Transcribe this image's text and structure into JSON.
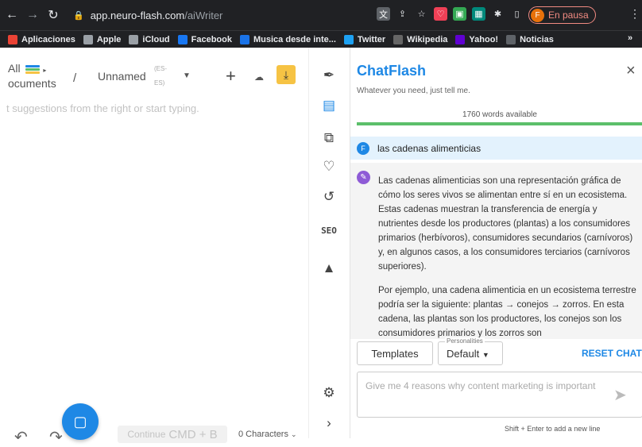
{
  "browser": {
    "url_host": "app.neuro-flash.com",
    "url_path": "/aiWriter",
    "profile_initial": "F",
    "profile_status": "En pausa"
  },
  "bookmarks": [
    {
      "label": "Aplicaciones",
      "color": "#ea4335"
    },
    {
      "label": "Apple",
      "color": "#9aa0a6"
    },
    {
      "label": "iCloud",
      "color": "#9aa0a6"
    },
    {
      "label": "Facebook",
      "color": "#1877f2"
    },
    {
      "label": "Musica desde inte...",
      "color": "#1a73e8"
    },
    {
      "label": "Twitter",
      "color": "#1da1f2"
    },
    {
      "label": "Wikipedia",
      "color": "#666666"
    },
    {
      "label": "Yahoo!",
      "color": "#6001d2"
    },
    {
      "label": "Noticias",
      "color": "#5f6368"
    }
  ],
  "bookmarks_more": "»",
  "editor": {
    "all_docs_line1": "All",
    "all_docs_line2": "ocuments",
    "separator": "/",
    "doc_name": "Unnamed",
    "lang_line1": "(ES-",
    "lang_line2": "ES)",
    "hint": "t suggestions from the right or start typing.",
    "continue_label": "Continue",
    "continue_shortcut": "CMD + B",
    "char_count": "0 Characters"
  },
  "toolbar": {
    "seo_label": "SEO"
  },
  "chat": {
    "title": "ChatFlash",
    "subtitle": "Whatever you need, just tell me.",
    "words_available": "1760 words available",
    "words_progress": 1.0,
    "user_initial": "F",
    "user_message": "las cadenas alimenticias",
    "bot_paragraph_1": "Las cadenas alimenticias son una representación gráfica de cómo los seres vivos se alimentan entre sí en un ecosistema. Estas cadenas muestran la transferencia de energía y nutrientes desde los productores (plantas) a los consumidores primarios (herbívoros), consumidores secundarios (carnívoros) y, en algunos casos, a los consumidores terciarios (carnívoros superiores).",
    "bot_paragraph_2": "Por ejemplo, una cadena alimenticia en un ecosistema terrestre podría ser la siguiente: plantas → conejos → zorros. En esta cadena, las plantas son los productores, los conejos son los consumidores primarios y los zorros son",
    "templates_label": "Templates",
    "personalities_label": "Personalities",
    "personality_value": "Default",
    "reset_label": "RESET CHAT",
    "input_placeholder": "Give me 4 reasons why content marketing is important",
    "shortcut_hint": "Shift + Enter to add a new line"
  },
  "colors": {
    "accent": "#1e88e5",
    "download": "#f6c344",
    "progress": "#5cbf6a"
  }
}
